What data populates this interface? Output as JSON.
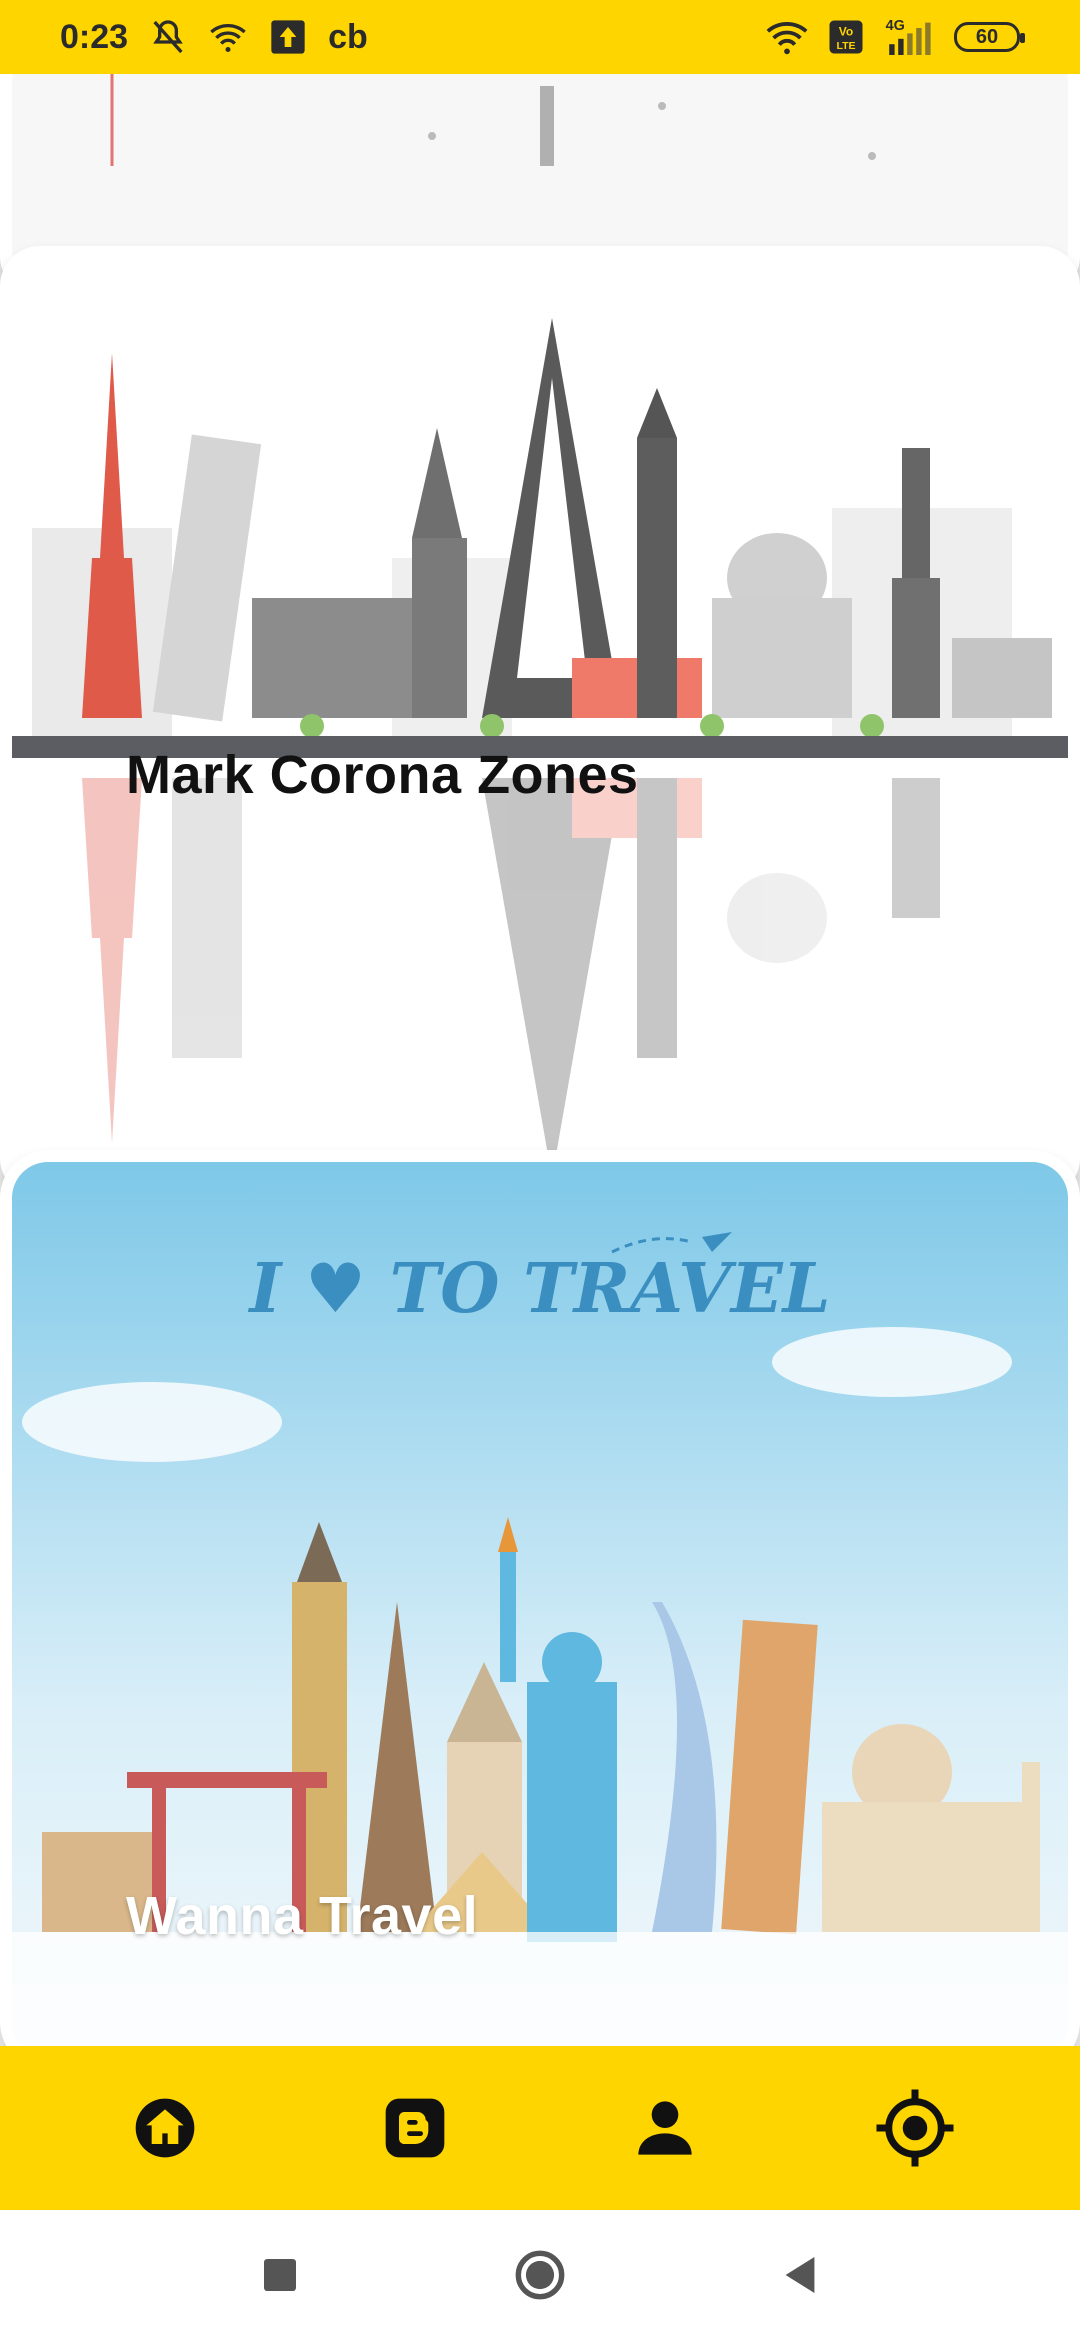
{
  "status_bar": {
    "time": "0:23",
    "carrier_label": "cb",
    "battery_level": "60",
    "network_type": "4G",
    "volte_label": "Vo LTE"
  },
  "cards": [
    {
      "title": ""
    },
    {
      "title": "Mark Corona Zones"
    },
    {
      "title": "Wanna Travel"
    }
  ],
  "travel_banner_text": "I ♥ TO TRAVEL",
  "bottom_nav": {
    "items": [
      {
        "icon": "home-icon"
      },
      {
        "icon": "blogger-icon"
      },
      {
        "icon": "person-icon"
      },
      {
        "icon": "location-target-icon"
      }
    ],
    "color": "#FFD500"
  },
  "system_nav": {
    "icons": [
      "recent-apps-icon",
      "home-circle-icon",
      "back-icon"
    ]
  },
  "colors": {
    "accent": "#FFD500",
    "text_dark": "#111111",
    "text_light": "#ffffff"
  }
}
